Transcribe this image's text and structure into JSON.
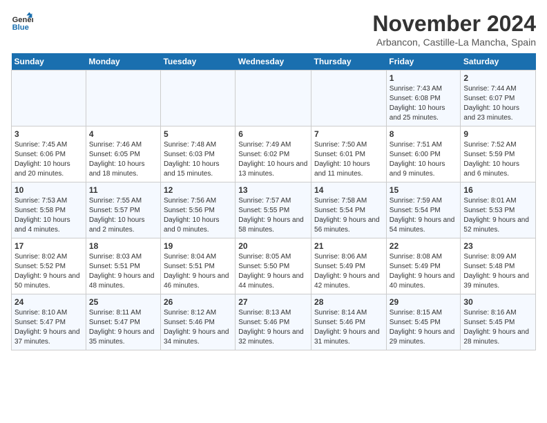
{
  "logo": {
    "line1": "General",
    "line2": "Blue"
  },
  "title": "November 2024",
  "subtitle": "Arbancon, Castille-La Mancha, Spain",
  "weekdays": [
    "Sunday",
    "Monday",
    "Tuesday",
    "Wednesday",
    "Thursday",
    "Friday",
    "Saturday"
  ],
  "weeks": [
    [
      {
        "day": "",
        "info": ""
      },
      {
        "day": "",
        "info": ""
      },
      {
        "day": "",
        "info": ""
      },
      {
        "day": "",
        "info": ""
      },
      {
        "day": "",
        "info": ""
      },
      {
        "day": "1",
        "info": "Sunrise: 7:43 AM\nSunset: 6:08 PM\nDaylight: 10 hours and 25 minutes."
      },
      {
        "day": "2",
        "info": "Sunrise: 7:44 AM\nSunset: 6:07 PM\nDaylight: 10 hours and 23 minutes."
      }
    ],
    [
      {
        "day": "3",
        "info": "Sunrise: 7:45 AM\nSunset: 6:06 PM\nDaylight: 10 hours and 20 minutes."
      },
      {
        "day": "4",
        "info": "Sunrise: 7:46 AM\nSunset: 6:05 PM\nDaylight: 10 hours and 18 minutes."
      },
      {
        "day": "5",
        "info": "Sunrise: 7:48 AM\nSunset: 6:03 PM\nDaylight: 10 hours and 15 minutes."
      },
      {
        "day": "6",
        "info": "Sunrise: 7:49 AM\nSunset: 6:02 PM\nDaylight: 10 hours and 13 minutes."
      },
      {
        "day": "7",
        "info": "Sunrise: 7:50 AM\nSunset: 6:01 PM\nDaylight: 10 hours and 11 minutes."
      },
      {
        "day": "8",
        "info": "Sunrise: 7:51 AM\nSunset: 6:00 PM\nDaylight: 10 hours and 9 minutes."
      },
      {
        "day": "9",
        "info": "Sunrise: 7:52 AM\nSunset: 5:59 PM\nDaylight: 10 hours and 6 minutes."
      }
    ],
    [
      {
        "day": "10",
        "info": "Sunrise: 7:53 AM\nSunset: 5:58 PM\nDaylight: 10 hours and 4 minutes."
      },
      {
        "day": "11",
        "info": "Sunrise: 7:55 AM\nSunset: 5:57 PM\nDaylight: 10 hours and 2 minutes."
      },
      {
        "day": "12",
        "info": "Sunrise: 7:56 AM\nSunset: 5:56 PM\nDaylight: 10 hours and 0 minutes."
      },
      {
        "day": "13",
        "info": "Sunrise: 7:57 AM\nSunset: 5:55 PM\nDaylight: 9 hours and 58 minutes."
      },
      {
        "day": "14",
        "info": "Sunrise: 7:58 AM\nSunset: 5:54 PM\nDaylight: 9 hours and 56 minutes."
      },
      {
        "day": "15",
        "info": "Sunrise: 7:59 AM\nSunset: 5:54 PM\nDaylight: 9 hours and 54 minutes."
      },
      {
        "day": "16",
        "info": "Sunrise: 8:01 AM\nSunset: 5:53 PM\nDaylight: 9 hours and 52 minutes."
      }
    ],
    [
      {
        "day": "17",
        "info": "Sunrise: 8:02 AM\nSunset: 5:52 PM\nDaylight: 9 hours and 50 minutes."
      },
      {
        "day": "18",
        "info": "Sunrise: 8:03 AM\nSunset: 5:51 PM\nDaylight: 9 hours and 48 minutes."
      },
      {
        "day": "19",
        "info": "Sunrise: 8:04 AM\nSunset: 5:51 PM\nDaylight: 9 hours and 46 minutes."
      },
      {
        "day": "20",
        "info": "Sunrise: 8:05 AM\nSunset: 5:50 PM\nDaylight: 9 hours and 44 minutes."
      },
      {
        "day": "21",
        "info": "Sunrise: 8:06 AM\nSunset: 5:49 PM\nDaylight: 9 hours and 42 minutes."
      },
      {
        "day": "22",
        "info": "Sunrise: 8:08 AM\nSunset: 5:49 PM\nDaylight: 9 hours and 40 minutes."
      },
      {
        "day": "23",
        "info": "Sunrise: 8:09 AM\nSunset: 5:48 PM\nDaylight: 9 hours and 39 minutes."
      }
    ],
    [
      {
        "day": "24",
        "info": "Sunrise: 8:10 AM\nSunset: 5:47 PM\nDaylight: 9 hours and 37 minutes."
      },
      {
        "day": "25",
        "info": "Sunrise: 8:11 AM\nSunset: 5:47 PM\nDaylight: 9 hours and 35 minutes."
      },
      {
        "day": "26",
        "info": "Sunrise: 8:12 AM\nSunset: 5:46 PM\nDaylight: 9 hours and 34 minutes."
      },
      {
        "day": "27",
        "info": "Sunrise: 8:13 AM\nSunset: 5:46 PM\nDaylight: 9 hours and 32 minutes."
      },
      {
        "day": "28",
        "info": "Sunrise: 8:14 AM\nSunset: 5:46 PM\nDaylight: 9 hours and 31 minutes."
      },
      {
        "day": "29",
        "info": "Sunrise: 8:15 AM\nSunset: 5:45 PM\nDaylight: 9 hours and 29 minutes."
      },
      {
        "day": "30",
        "info": "Sunrise: 8:16 AM\nSunset: 5:45 PM\nDaylight: 9 hours and 28 minutes."
      }
    ]
  ]
}
